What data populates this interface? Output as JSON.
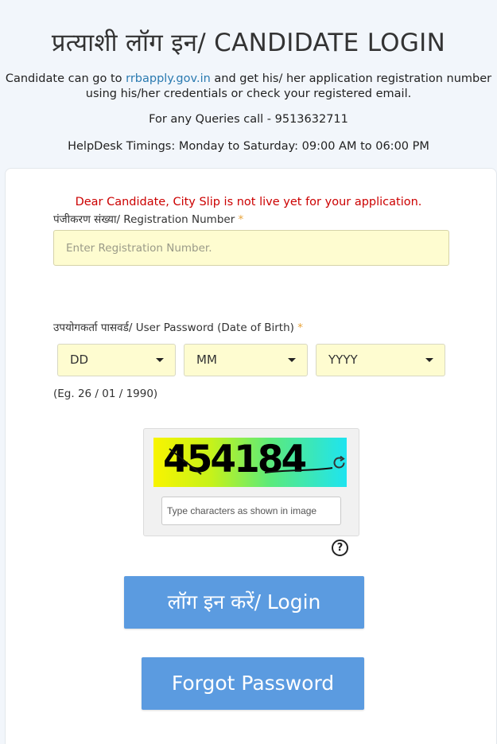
{
  "header": {
    "title": "प्रत्याशी लॉग इन/ CANDIDATE LOGIN",
    "info_prefix": "Candidate can go to ",
    "info_link": "rrbapply.gov.in",
    "info_suffix": " and get his/ her application registration number using his/her credentials or check your registered email.",
    "queries": "For any Queries call - 9513632711",
    "helpdesk": "HelpDesk Timings: Monday to Saturday: 09:00 AM to 06:00 PM"
  },
  "form": {
    "alert": "Dear Candidate, City Slip is not live yet for your application.",
    "registration_label": "पंजीकरण संख्या/ Registration Number",
    "registration_placeholder": "Enter Registration Number.",
    "password_label": "उपयोगकर्ता पासवर्ड/ User Password (Date of Birth)",
    "required_mark": "*",
    "dob": {
      "day": "DD",
      "month": "MM",
      "year": "YYYY"
    },
    "example": "(Eg. 26 / 01 / 1990)",
    "captcha_text": "454184",
    "captcha_placeholder": "Type characters as shown in image",
    "help_symbol": "?",
    "login_label": "लॉग इन करें/ Login",
    "forgot_label": "Forgot Password"
  },
  "colors": {
    "button": "#5b9be0",
    "alert": "#cc0000",
    "input_bg": "#fefcd0",
    "link": "#2a7ab0"
  }
}
